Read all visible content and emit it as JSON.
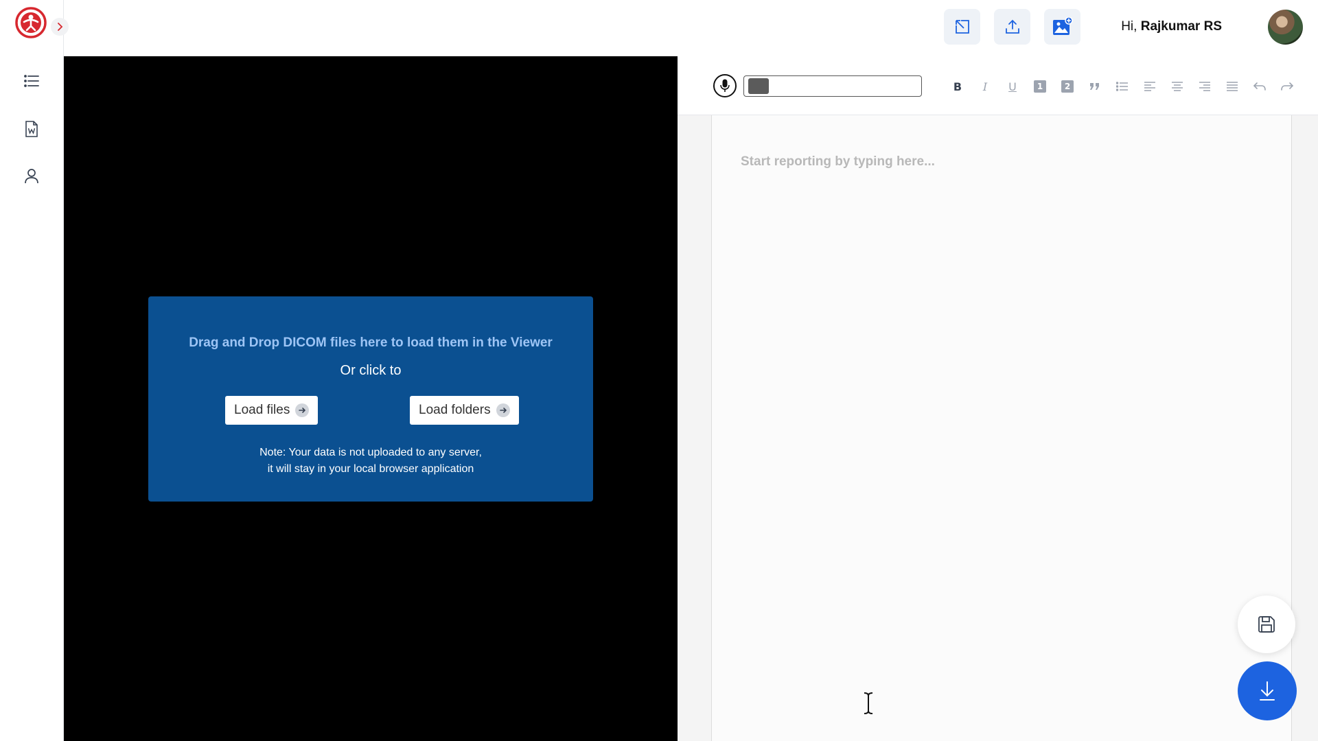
{
  "header": {
    "greeting_prefix": "Hi,",
    "user_name": "Rajkumar RS"
  },
  "viewer": {
    "drop_title": "Drag and Drop DICOM files here to load them in the Viewer",
    "or_text": "Or click to",
    "load_files_label": "Load files",
    "load_folders_label": "Load folders",
    "note_line1": "Note: Your data is not uploaded to any server,",
    "note_line2": "it will stay in your local browser application"
  },
  "editor": {
    "placeholder": "Start reporting by typing here...",
    "toolbar_bold": "B",
    "toolbar_italic": "I",
    "toolbar_underline": "U",
    "toolbar_h1": "1",
    "toolbar_h2": "2"
  },
  "colors": {
    "accent": "#1d63e0",
    "dropzone_bg": "#0b5091",
    "brand_red": "#d7282f"
  },
  "icons": {
    "logo": "brand-logo-icon",
    "expand": "chevron-right-icon",
    "nav_list": "list-icon",
    "nav_document": "word-document-icon",
    "nav_user": "user-icon",
    "header_select": "select-cursor-icon",
    "header_upload": "upload-icon",
    "header_image": "add-image-icon",
    "save": "save-icon",
    "download": "download-icon"
  }
}
